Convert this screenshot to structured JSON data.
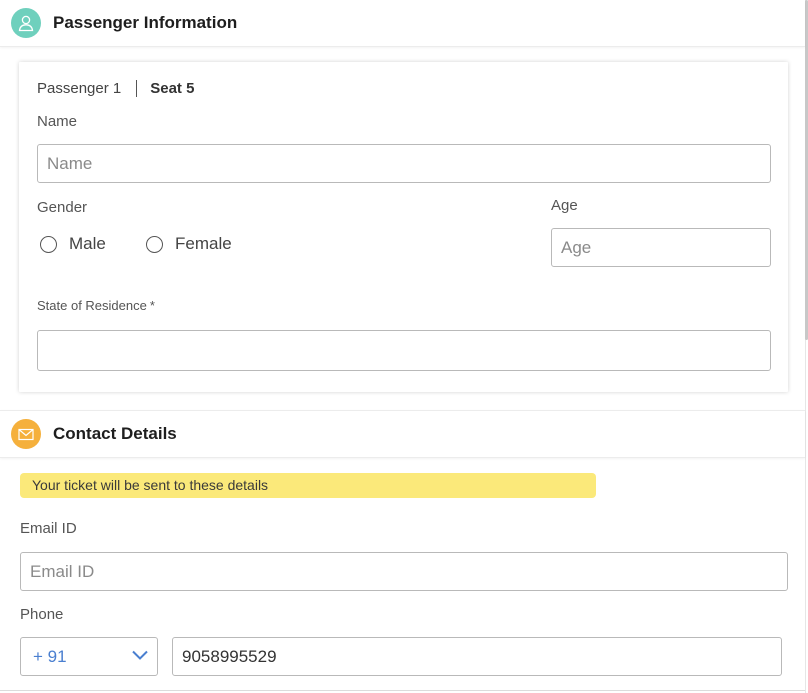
{
  "passenger_section": {
    "title": "Passenger Information",
    "passenger_label": "Passenger 1",
    "seat_label": "Seat 5",
    "name": {
      "label": "Name",
      "placeholder": "Name",
      "value": ""
    },
    "gender": {
      "label": "Gender",
      "options": [
        "Male",
        "Female"
      ]
    },
    "age": {
      "label": "Age",
      "placeholder": "Age",
      "value": ""
    },
    "state": {
      "label": "State of Residence",
      "required_mark": "*",
      "value": ""
    },
    "icon_color": "#6fd0bd"
  },
  "contact_section": {
    "title": "Contact Details",
    "notice": "Your ticket will be sent to these details",
    "email": {
      "label": "Email ID",
      "placeholder": "Email ID",
      "value": ""
    },
    "phone": {
      "label": "Phone",
      "country_code": "+ 91",
      "value": "9058995529"
    },
    "icon_color": "#f5b03c",
    "notice_color": "#fbe97a"
  },
  "icons": [
    "user-icon",
    "mail-icon",
    "chevron-down-icon"
  ]
}
